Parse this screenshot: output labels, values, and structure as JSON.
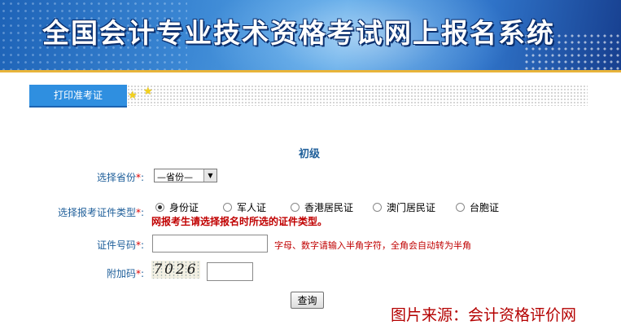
{
  "banner": {
    "title": "全国会计专业技术资格考试网上报名系统"
  },
  "tabs": [
    {
      "label": "打印准考证"
    }
  ],
  "form": {
    "level": "初级",
    "province": {
      "label": "选择省份",
      "required": "*",
      "colon": ":",
      "selected": "—省份—"
    },
    "id_type": {
      "label": "选择报考证件类型",
      "required": "*",
      "colon": ":",
      "options": [
        {
          "label": "身份证",
          "checked": true
        },
        {
          "label": "军人证",
          "checked": false
        },
        {
          "label": "香港居民证",
          "checked": false
        },
        {
          "label": "澳门居民证",
          "checked": false
        },
        {
          "label": "台胞证",
          "checked": false
        }
      ],
      "warning": "网报考生请选择报名时所选的证件类型。"
    },
    "id_number": {
      "label": "证件号码",
      "required": "*",
      "colon": ":",
      "value": "",
      "hint": "字母、数字请输入半角字符，全角会自动转为半角"
    },
    "captcha": {
      "label": "附加码",
      "required": "*",
      "colon": ":",
      "image_text": "7026",
      "value": ""
    },
    "submit_label": "查询"
  },
  "watermark": "图片来源：会计资格评价网",
  "colors": {
    "banner_blue": "#2f73c8",
    "tab_blue": "#2f8fe0",
    "label_blue": "#1f5f9a",
    "warning_red": "#c00000",
    "gold_line": "#e8b43a"
  }
}
